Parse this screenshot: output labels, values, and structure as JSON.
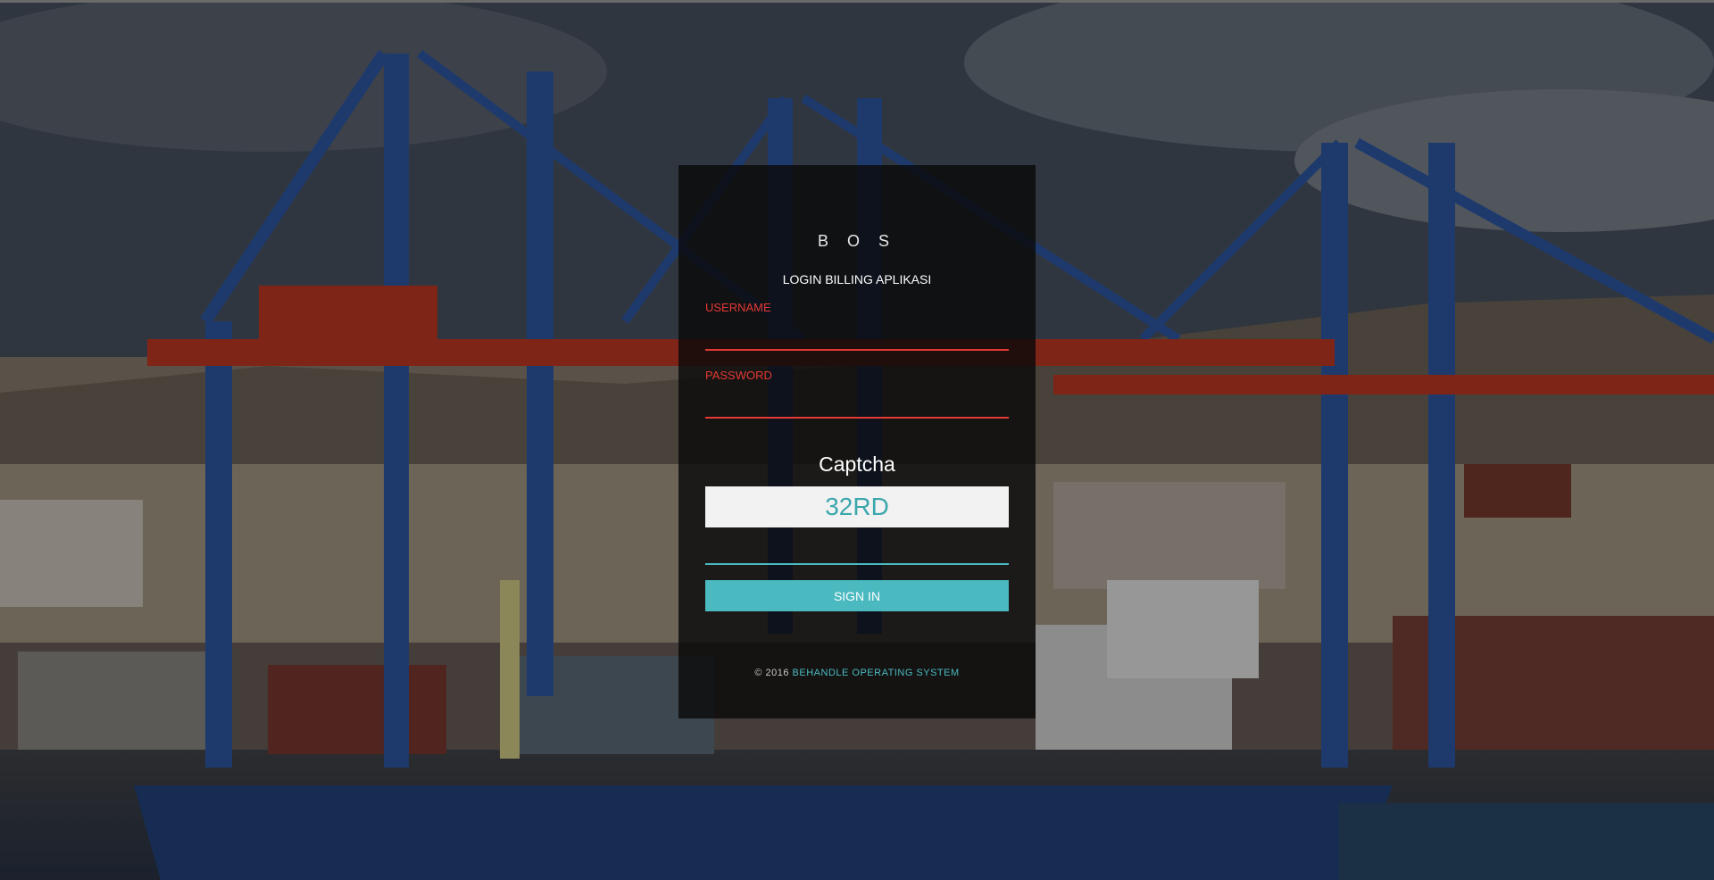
{
  "login": {
    "brand": "B O S",
    "subtitle": "LOGIN BILLING APLIKASI",
    "username": {
      "label": "USERNAME",
      "value": ""
    },
    "password": {
      "label": "PASSWORD",
      "value": ""
    },
    "captcha": {
      "title": "Captcha",
      "code": "32RD",
      "value": ""
    },
    "signin_label": "SIGN IN",
    "footer": {
      "prefix": "© 2016 ",
      "link": "BEHANDLE OPERATING SYSTEM"
    }
  },
  "colors": {
    "accent": "#4ab9c0",
    "error": "#e53935",
    "card_bg": "#0a0a0a"
  },
  "background": {
    "description_icon": "port-crane-scene-image"
  }
}
